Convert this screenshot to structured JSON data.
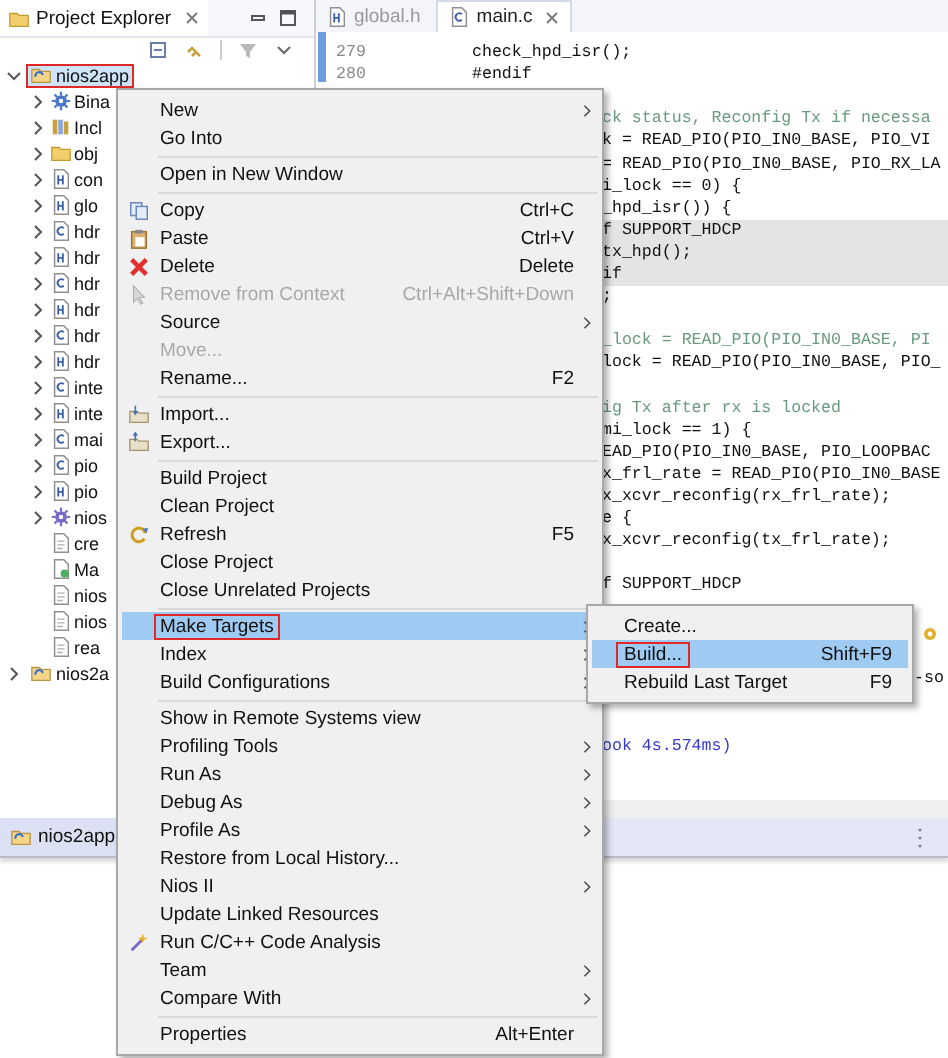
{
  "explorer": {
    "title": "Project Explorer",
    "tree": [
      {
        "label": "nios2app",
        "kind": "project",
        "expanded": true,
        "selected": true,
        "marked": true,
        "children": [
          {
            "label": "Bina",
            "kind": "binaries",
            "expandable": true
          },
          {
            "label": "Incl",
            "kind": "includes",
            "expandable": true
          },
          {
            "label": "obj",
            "kind": "folder",
            "expandable": true
          },
          {
            "label": "con",
            "kind": "header",
            "expandable": true
          },
          {
            "label": "glo",
            "kind": "header",
            "expandable": true
          },
          {
            "label": "hdr",
            "kind": "source",
            "expandable": true
          },
          {
            "label": "hdr",
            "kind": "header",
            "expandable": true
          },
          {
            "label": "hdr",
            "kind": "source",
            "expandable": true
          },
          {
            "label": "hdr",
            "kind": "header",
            "expandable": true
          },
          {
            "label": "hdr",
            "kind": "source",
            "expandable": true
          },
          {
            "label": "hdr",
            "kind": "header",
            "expandable": true
          },
          {
            "label": "inte",
            "kind": "source",
            "expandable": true
          },
          {
            "label": "inte",
            "kind": "header",
            "expandable": true
          },
          {
            "label": "mai",
            "kind": "source",
            "expandable": true
          },
          {
            "label": "pio",
            "kind": "source",
            "expandable": true
          },
          {
            "label": "pio",
            "kind": "header",
            "expandable": true
          },
          {
            "label": "nios",
            "kind": "settings",
            "expandable": true
          },
          {
            "label": "cre",
            "kind": "text",
            "expandable": false
          },
          {
            "label": "Ma",
            "kind": "makefile",
            "expandable": false
          },
          {
            "label": "nios",
            "kind": "text",
            "expandable": false
          },
          {
            "label": "nios",
            "kind": "text",
            "expandable": false
          },
          {
            "label": "rea",
            "kind": "text",
            "expandable": false
          }
        ]
      },
      {
        "label": "nios2a",
        "kind": "project",
        "expanded": false,
        "selected": false,
        "marked": false
      }
    ]
  },
  "editor": {
    "tabs": [
      {
        "label": "global.h",
        "selected": false
      },
      {
        "label": "main.c",
        "selected": true
      }
    ],
    "lines": [
      {
        "kind": "code",
        "number": "279",
        "text": "check_hpd_isr();",
        "highlighted": false
      },
      {
        "kind": "code",
        "number": "280",
        "text": "#endif",
        "highlighted": false
      },
      {
        "kind": "blank"
      },
      {
        "kind": "comment",
        "text": "ck status, Reconfig Tx if necessa",
        "highlighted": false
      },
      {
        "kind": "code",
        "text": "k = READ_PIO(PIO_IN0_BASE, PIO_VI",
        "highlighted": false
      },
      {
        "kind": "code",
        "text": "= READ_PIO(PIO_IN0_BASE, PIO_RX_LA",
        "highlighted": false
      },
      {
        "kind": "code",
        "text": "i_lock == 0) {",
        "highlighted": false
      },
      {
        "kind": "code",
        "text": "_hpd_isr()) {",
        "highlighted": false
      },
      {
        "kind": "code",
        "text": "f SUPPORT_HDCP",
        "highlighted": true
      },
      {
        "kind": "code",
        "text": "tx_hpd();",
        "highlighted": true
      },
      {
        "kind": "code",
        "text": "if",
        "highlighted": true
      },
      {
        "kind": "code",
        "text": ";",
        "highlighted": false
      },
      {
        "kind": "blank"
      },
      {
        "kind": "comment",
        "text": "_lock = READ_PIO(PIO_IN0_BASE, PI",
        "highlighted": false
      },
      {
        "kind": "code",
        "text": "lock = READ_PIO(PIO_IN0_BASE, PIO_",
        "highlighted": false
      },
      {
        "kind": "blank"
      },
      {
        "kind": "comment",
        "text": "ig Tx after rx is locked",
        "highlighted": false
      },
      {
        "kind": "code",
        "text": "mi_lock == 1) {",
        "highlighted": false
      },
      {
        "kind": "code",
        "text": "EAD_PIO(PIO_IN0_BASE, PIO_LOOPBAC",
        "highlighted": false
      },
      {
        "kind": "code",
        "text": "x_frl_rate = READ_PIO(PIO_IN0_BASE",
        "highlighted": false
      },
      {
        "kind": "code",
        "text": "x_xcvr_reconfig(rx_frl_rate);",
        "highlighted": false
      },
      {
        "kind": "code",
        "text": "e {",
        "highlighted": false
      },
      {
        "kind": "code",
        "text": "x_xcvr_reconfig(tx_frl_rate);",
        "highlighted": false
      },
      {
        "kind": "blank"
      },
      {
        "kind": "code",
        "text": "f SUPPORT_HDCP",
        "highlighted": false
      }
    ]
  },
  "console": {
    "lines": [
      {
        "kind": "output",
        "text": "-so"
      },
      {
        "kind": "blank"
      },
      {
        "kind": "blank"
      },
      {
        "kind": "info",
        "text": "ook 4s.574ms)"
      }
    ]
  },
  "bottom_panel": {
    "tab": "nios2app"
  },
  "context_menu": {
    "items": [
      {
        "kind": "item",
        "label": "New",
        "submenu": true,
        "disabled": false,
        "selected": false,
        "marked": false
      },
      {
        "kind": "item",
        "label": "Go Into",
        "submenu": false,
        "disabled": false,
        "selected": false,
        "marked": false
      },
      {
        "kind": "separator"
      },
      {
        "kind": "item",
        "label": "Open in New Window",
        "submenu": false,
        "disabled": false,
        "selected": false,
        "marked": false
      },
      {
        "kind": "separator"
      },
      {
        "kind": "item",
        "label": "Copy",
        "shortcut": "Ctrl+C",
        "submenu": false,
        "disabled": false,
        "selected": false,
        "marked": false
      },
      {
        "kind": "item",
        "label": "Paste",
        "shortcut": "Ctrl+V",
        "submenu": false,
        "disabled": false,
        "selected": false,
        "marked": false
      },
      {
        "kind": "item",
        "label": "Delete",
        "shortcut": "Delete",
        "submenu": false,
        "disabled": false,
        "selected": false,
        "marked": false
      },
      {
        "kind": "item",
        "label": "Remove from Context",
        "shortcut": "Ctrl+Alt+Shift+Down",
        "submenu": false,
        "disabled": true,
        "selected": false,
        "marked": false
      },
      {
        "kind": "item",
        "label": "Source",
        "submenu": true,
        "disabled": false,
        "selected": false,
        "marked": false
      },
      {
        "kind": "item",
        "label": "Move...",
        "submenu": false,
        "disabled": true,
        "selected": false,
        "marked": false
      },
      {
        "kind": "item",
        "label": "Rename...",
        "shortcut": "F2",
        "submenu": false,
        "disabled": false,
        "selected": false,
        "marked": false
      },
      {
        "kind": "separator"
      },
      {
        "kind": "item",
        "label": "Import...",
        "submenu": false,
        "disabled": false,
        "selected": false,
        "marked": false
      },
      {
        "kind": "item",
        "label": "Export...",
        "submenu": false,
        "disabled": false,
        "selected": false,
        "marked": false
      },
      {
        "kind": "separator"
      },
      {
        "kind": "item",
        "label": "Build Project",
        "submenu": false,
        "disabled": false,
        "selected": false,
        "marked": false
      },
      {
        "kind": "item",
        "label": "Clean Project",
        "submenu": false,
        "disabled": false,
        "selected": false,
        "marked": false
      },
      {
        "kind": "item",
        "label": "Refresh",
        "shortcut": "F5",
        "submenu": false,
        "disabled": false,
        "selected": false,
        "marked": false
      },
      {
        "kind": "item",
        "label": "Close Project",
        "submenu": false,
        "disabled": false,
        "selected": false,
        "marked": false
      },
      {
        "kind": "item",
        "label": "Close Unrelated Projects",
        "submenu": false,
        "disabled": false,
        "selected": false,
        "marked": false
      },
      {
        "kind": "separator"
      },
      {
        "kind": "item",
        "label": "Make Targets",
        "submenu": true,
        "disabled": false,
        "selected": true,
        "marked": true
      },
      {
        "kind": "item",
        "label": "Index",
        "submenu": true,
        "disabled": false,
        "selected": false,
        "marked": false
      },
      {
        "kind": "item",
        "label": "Build Configurations",
        "submenu": true,
        "disabled": false,
        "selected": false,
        "marked": false
      },
      {
        "kind": "separator"
      },
      {
        "kind": "item",
        "label": "Show in Remote Systems view",
        "submenu": false,
        "disabled": false,
        "selected": false,
        "marked": false
      },
      {
        "kind": "item",
        "label": "Profiling Tools",
        "submenu": true,
        "disabled": false,
        "selected": false,
        "marked": false
      },
      {
        "kind": "item",
        "label": "Run As",
        "submenu": true,
        "disabled": false,
        "selected": false,
        "marked": false
      },
      {
        "kind": "item",
        "label": "Debug As",
        "submenu": true,
        "disabled": false,
        "selected": false,
        "marked": false
      },
      {
        "kind": "item",
        "label": "Profile As",
        "submenu": true,
        "disabled": false,
        "selected": false,
        "marked": false
      },
      {
        "kind": "item",
        "label": "Restore from Local History...",
        "submenu": false,
        "disabled": false,
        "selected": false,
        "marked": false
      },
      {
        "kind": "item",
        "label": "Nios II",
        "submenu": true,
        "disabled": false,
        "selected": false,
        "marked": false
      },
      {
        "kind": "item",
        "label": "Update Linked Resources",
        "submenu": false,
        "disabled": false,
        "selected": false,
        "marked": false
      },
      {
        "kind": "item",
        "label": "Run C/C++ Code Analysis",
        "submenu": false,
        "disabled": false,
        "selected": false,
        "marked": false
      },
      {
        "kind": "item",
        "label": "Team",
        "submenu": true,
        "disabled": false,
        "selected": false,
        "marked": false
      },
      {
        "kind": "item",
        "label": "Compare With",
        "submenu": true,
        "disabled": false,
        "selected": false,
        "marked": false
      },
      {
        "kind": "separator"
      },
      {
        "kind": "item",
        "label": "Properties",
        "shortcut": "Alt+Enter",
        "submenu": false,
        "disabled": false,
        "selected": false,
        "marked": false
      }
    ]
  },
  "submenu": {
    "items": [
      {
        "label": "Create...",
        "selected": false,
        "marked": false
      },
      {
        "label": "Build...",
        "shortcut": "Shift+F9",
        "selected": true,
        "marked": true
      },
      {
        "label": "Rebuild Last Target",
        "shortcut": "F9",
        "selected": false,
        "marked": false
      }
    ]
  }
}
